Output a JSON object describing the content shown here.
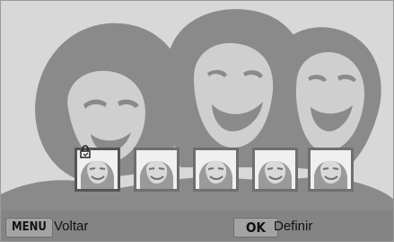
{
  "screen": {
    "background_color": "#d8d8d8",
    "silhouette_color": "#8a8a8a"
  },
  "face_thumbnails": {
    "count": 5,
    "selected_index": 0,
    "selected_icon": "selection-marker-icon"
  },
  "footer": {
    "menu_key": "MENU",
    "menu_action": "Voltar",
    "ok_key": "OK",
    "ok_action": "Definir"
  }
}
